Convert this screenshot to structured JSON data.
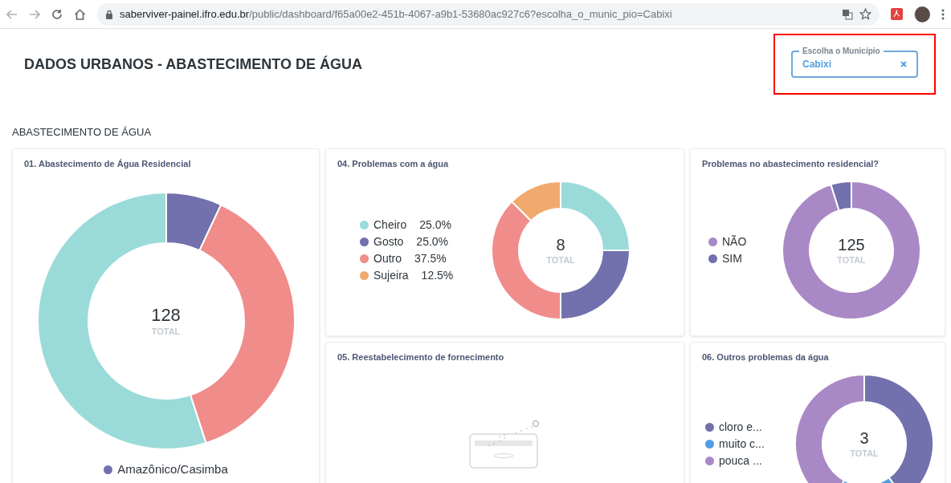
{
  "browser": {
    "url_host": "saberviver-painel.ifro.edu.br",
    "url_path": "/public/dashboard/f65a00e2-451b-4067-a9b1-53680ac927c6?escolha_o_munic_pio=Cabixi"
  },
  "header": {
    "title": "DADOS URBANOS - ABASTECIMENTO DE ÁGUA",
    "filter": {
      "label": "Escolha o Município",
      "value": "Cabixi",
      "highlighted": true
    }
  },
  "section_title": "ABASTECIMENTO DE ÁGUA",
  "cards": [
    {
      "kind": "donut",
      "title": "01. Abastecimento de Água Residencial",
      "total": "128",
      "total_label": "TOTAL",
      "legend": [
        {
          "label": "Amazônico/Casimba",
          "color": "#7270ad"
        }
      ]
    },
    {
      "kind": "donut",
      "title": "04. Problemas com a água",
      "total": "8",
      "total_label": "TOTAL",
      "legend": [
        {
          "color": "#9adbd9"
        },
        {
          "color": "#7270ad"
        },
        {
          "color": "#f08c8a"
        },
        {
          "color": "#f2a96e"
        }
      ],
      "chart_data": {
        "type": "donut",
        "categories": [
          "Cheiro",
          "Gosto",
          "Outro",
          "Sujeira"
        ],
        "values": [
          25,
          25,
          37.5,
          12.5
        ],
        "value_labels": [
          "25.0%",
          "25.0%",
          "37.5%",
          "12.5%"
        ]
      }
    },
    {
      "kind": "donut",
      "title": "Problemas no abastecimento residencial?",
      "total": "125",
      "total_label": "TOTAL",
      "legend": [
        {
          "label": "NÃO",
          "color": "#a989c5"
        },
        {
          "label": "SIM",
          "color": "#7270ad"
        }
      ]
    },
    {
      "kind": "empty",
      "title": "05. Reestabelecimento de fornecimento"
    },
    {
      "kind": "donut",
      "title": "06. Outros problemas da água",
      "total": "3",
      "total_label": "TOTAL",
      "legend": [
        {
          "label": "cloro e...",
          "color": "#7270ad"
        },
        {
          "label": "muito c...",
          "color": "#509ee3"
        },
        {
          "label": "pouca ...",
          "color": "#a989c5"
        }
      ]
    }
  ]
}
